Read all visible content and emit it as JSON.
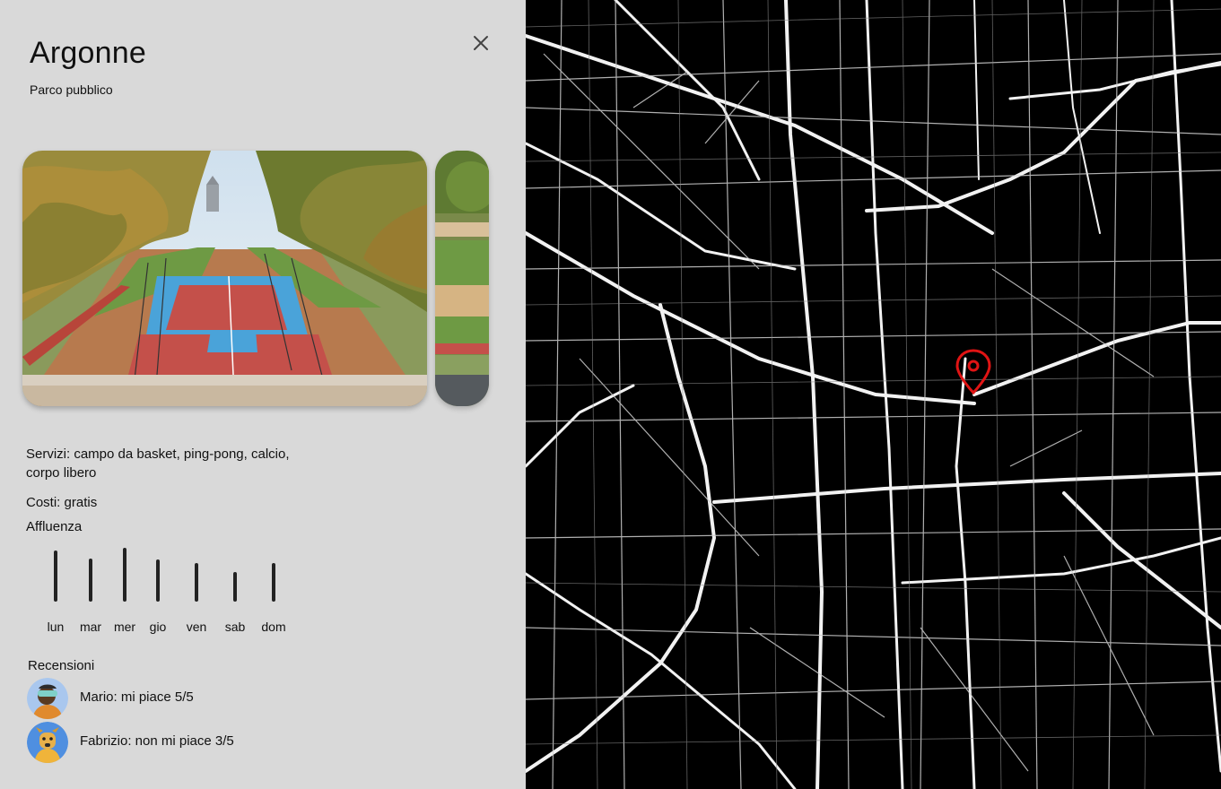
{
  "place": {
    "title": "Argonne",
    "category": "Parco pubblico"
  },
  "close_icon": "close-icon",
  "photos": {
    "main_alt": "Parco Argonne",
    "side_alt": "Parco Argonne"
  },
  "info": {
    "services": "Servizi: campo da basket, ping-pong, calcio, corpo libero",
    "costs": "Costi: gratis",
    "affluenza_label": "Affluenza"
  },
  "affluenza": {
    "days": [
      {
        "label": "lun",
        "level": 0.95
      },
      {
        "label": "mar",
        "level": 0.8
      },
      {
        "label": "mer",
        "level": 1.0
      },
      {
        "label": "gio",
        "level": 0.78
      },
      {
        "label": "ven",
        "level": 0.72
      },
      {
        "label": "sab",
        "level": 0.55
      },
      {
        "label": "dom",
        "level": 0.72
      }
    ]
  },
  "reviews": {
    "label": "Recensioni",
    "items": [
      {
        "text": "Mario: mi piace 5/5"
      },
      {
        "text": "Fabrizio: non mi piace 3/5"
      }
    ]
  },
  "map": {
    "pin_color": "#e01414",
    "road_color": "#ffffff"
  }
}
